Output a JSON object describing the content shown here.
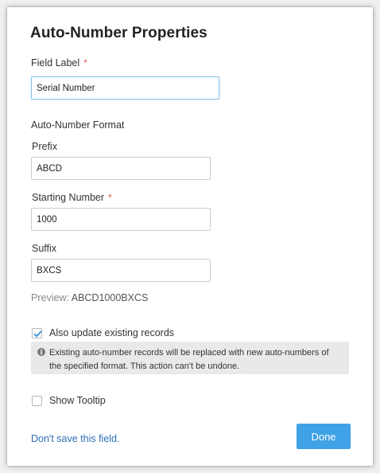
{
  "dialog": {
    "title": "Auto-Number Properties",
    "field_label": {
      "label": "Field Label",
      "required_mark": "*",
      "value": "Serial Number"
    },
    "format_section_label": "Auto-Number Format",
    "prefix": {
      "label": "Prefix",
      "value": "ABCD"
    },
    "starting_number": {
      "label": "Starting Number",
      "required_mark": "*",
      "value": "1000"
    },
    "suffix": {
      "label": "Suffix",
      "value": "BXCS"
    },
    "preview": {
      "label": "Preview:",
      "value": "ABCD1000BXCS"
    },
    "update_existing": {
      "label": "Also update existing records",
      "checked": true
    },
    "info": {
      "icon": "info-icon",
      "text": "Existing auto-number records will be replaced with new auto-numbers of the specified format. This action can't be undone."
    },
    "show_tooltip": {
      "label": "Show Tooltip",
      "checked": false
    },
    "dont_save_link": "Don't save this field.",
    "done_button": "Done"
  },
  "colors": {
    "accent": "#3fa2e6",
    "link": "#2d6fb5",
    "required": "#e05a4f",
    "info_bg": "#e9e9e9"
  }
}
